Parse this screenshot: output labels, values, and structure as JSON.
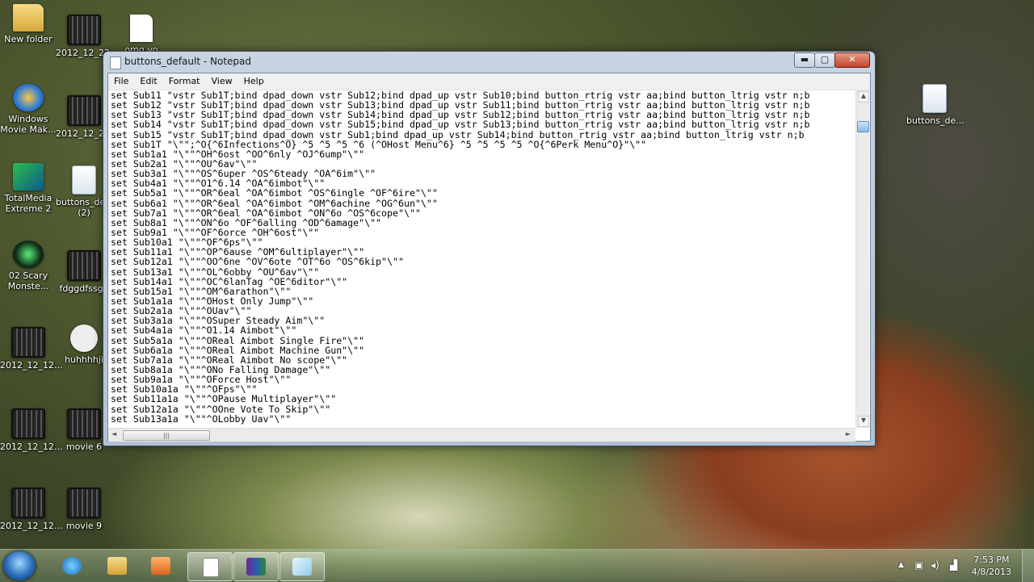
{
  "desktop_icons": [
    {
      "label": "New folder",
      "icon": "folder"
    },
    {
      "label": "2012_12_22...",
      "icon": "film"
    },
    {
      "label": "omg.vo",
      "icon": "file"
    },
    {
      "label": "Windows Movie Mak...",
      "icon": "wmm"
    },
    {
      "label": "2012_12_22...",
      "icon": "film"
    },
    {
      "label": "TotalMedia Extreme 2",
      "icon": "tme"
    },
    {
      "label": "buttons_de... (2)",
      "icon": "doc"
    },
    {
      "label": "02 Scary Monste...",
      "icon": "scary"
    },
    {
      "label": "fdggdfssgh",
      "icon": "film"
    },
    {
      "label": "2012_12_12...",
      "icon": "film"
    },
    {
      "label": "huhhhhji",
      "icon": "troll"
    },
    {
      "label": "2012_12_12...",
      "icon": "film"
    },
    {
      "label": "movie 6",
      "icon": "film"
    },
    {
      "label": "2012_12_12...",
      "icon": "film"
    },
    {
      "label": "movie 9",
      "icon": "film"
    },
    {
      "label": "buttons_de...",
      "icon": "doc"
    }
  ],
  "window": {
    "title": "buttons_default - Notepad",
    "controls": {
      "minimize": "▬",
      "maximize": "▢",
      "close": "✕"
    },
    "menu": [
      "File",
      "Edit",
      "Format",
      "View",
      "Help"
    ]
  },
  "editor_lines": [
    "set Sub11 \"vstr Sub1T;bind dpad_down vstr Sub12;bind dpad_up vstr Sub10;bind button_rtrig vstr aa;bind button_ltrig vstr n;b",
    "set Sub12 \"vstr Sub1T;bind dpad_down vstr Sub13;bind dpad_up vstr Sub11;bind button_rtrig vstr aa;bind button_ltrig vstr n;b",
    "set Sub13 \"vstr Sub1T;bind dpad_down vstr Sub14;bind dpad_up vstr Sub12;bind button_rtrig vstr aa;bind button_ltrig vstr n;b",
    "set Sub14 \"vstr Sub1T;bind dpad_down vstr Sub15;bind dpad_up vstr Sub13;bind button_rtrig vstr aa;bind button_ltrig vstr n;b",
    "set Sub15 \"vstr Sub1T;bind dpad_down vstr Sub1;bind dpad_up vstr Sub14;bind button_rtrig vstr aa;bind button_ltrig vstr n;b",
    "set Sub1T \"\\\"\";^O{^6Infections^O} ^5 ^5 ^5 ^6 (^OHost Menu^6} ^5 ^5 ^5 ^5 ^O{^6Perk Menu^O}\"\\\"\"",
    "set Sub1a1 \"\\\"\"^OH^6ost ^OO^6nly ^OJ^6ump\"\\\"\"",
    "set Sub2a1 \"\\\"\"^OU^6av\"\\\"\"",
    "set Sub3a1 \"\\\"\"^OS^6uper ^OS^6teady ^OA^6im\"\\\"\"",
    "set Sub4a1 \"\\\"\"^O1^6.14 ^OA^6imbot\"\\\"\"",
    "set Sub5a1 \"\\\"\"^OR^6eal ^OA^6imbot ^OS^6ingle ^OF^6ire\"\\\"\"",
    "set Sub6a1 \"\\\"\"^OR^6eal ^OA^6imbot ^OM^6achine ^OG^6un\"\\\"\"",
    "set Sub7a1 \"\\\"\"^OR^6eal ^OA^6imbot ^ON^6o ^OS^6cope\"\\\"\"",
    "set Sub8a1 \"\\\"\"^ON^6o ^OF^6alling ^OD^6amage\"\\\"\"",
    "set Sub9a1 \"\\\"\"^OF^6orce ^OH^6ost\"\\\"\"",
    "set Sub10a1 \"\\\"\"^OF^6ps\"\\\"\"",
    "set Sub11a1 \"\\\"\"^OP^6ause ^OM^6ultiplayer\"\\\"\"",
    "set Sub12a1 \"\\\"\"^OO^6ne ^OV^6ote ^OT^6o ^OS^6kip\"\\\"\"",
    "set Sub13a1 \"\\\"\"^OL^6obby ^OU^6av\"\\\"\"",
    "set Sub14a1 \"\\\"\"^OC^6lanTag ^OE^6ditor\"\\\"\"",
    "set Sub15a1 \"\\\"\"^OM^6arathon\"\\\"\"",
    "set Sub1a1a \"\\\"\"^OHost Only Jump\"\\\"\"",
    "set Sub2a1a \"\\\"\"^OUav\"\\\"\"",
    "set Sub3a1a \"\\\"\"^OSuper Steady Aim\"\\\"\"",
    "set Sub4a1a \"\\\"\"^O1.14 Aimbot\"\\\"\"",
    "set Sub5a1a \"\\\"\"^OReal Aimbot Single Fire\"\\\"\"",
    "set Sub6a1a \"\\\"\"^OReal Aimbot Machine Gun\"\\\"\"",
    "set Sub7a1a \"\\\"\"^OReal Aimbot No scope\"\\\"\"",
    "set Sub8a1a \"\\\"\"^ONo Falling Damage\"\\\"\"",
    "set Sub9a1a \"\\\"\"^OForce Host\"\\\"\"",
    "set Sub10a1a \"\\\"\"^OFps\"\\\"\"",
    "set Sub11a1a \"\\\"\"^OPause Multiplayer\"\\\"\"",
    "set Sub12a1a \"\\\"\"^OOne Vote To Skip\"\\\"\"",
    "set Sub13a1a \"\\\"\"^OLobby Uav\"\\\"\""
  ],
  "scrollbar": {
    "up": "▲",
    "down": "▼",
    "left": "◄",
    "right": "►",
    "grip": "|||"
  },
  "taskbar": {
    "items": [
      "start-button",
      "internet-explorer",
      "file-explorer",
      "media-player",
      "notepad-document",
      "winrar",
      "notepad"
    ],
    "tray": {
      "show_hidden": "▲",
      "time": "7:53 PM",
      "date": "4/8/2013"
    }
  },
  "colors": {
    "accent": "#2a6cb8",
    "close": "#c2432a"
  }
}
